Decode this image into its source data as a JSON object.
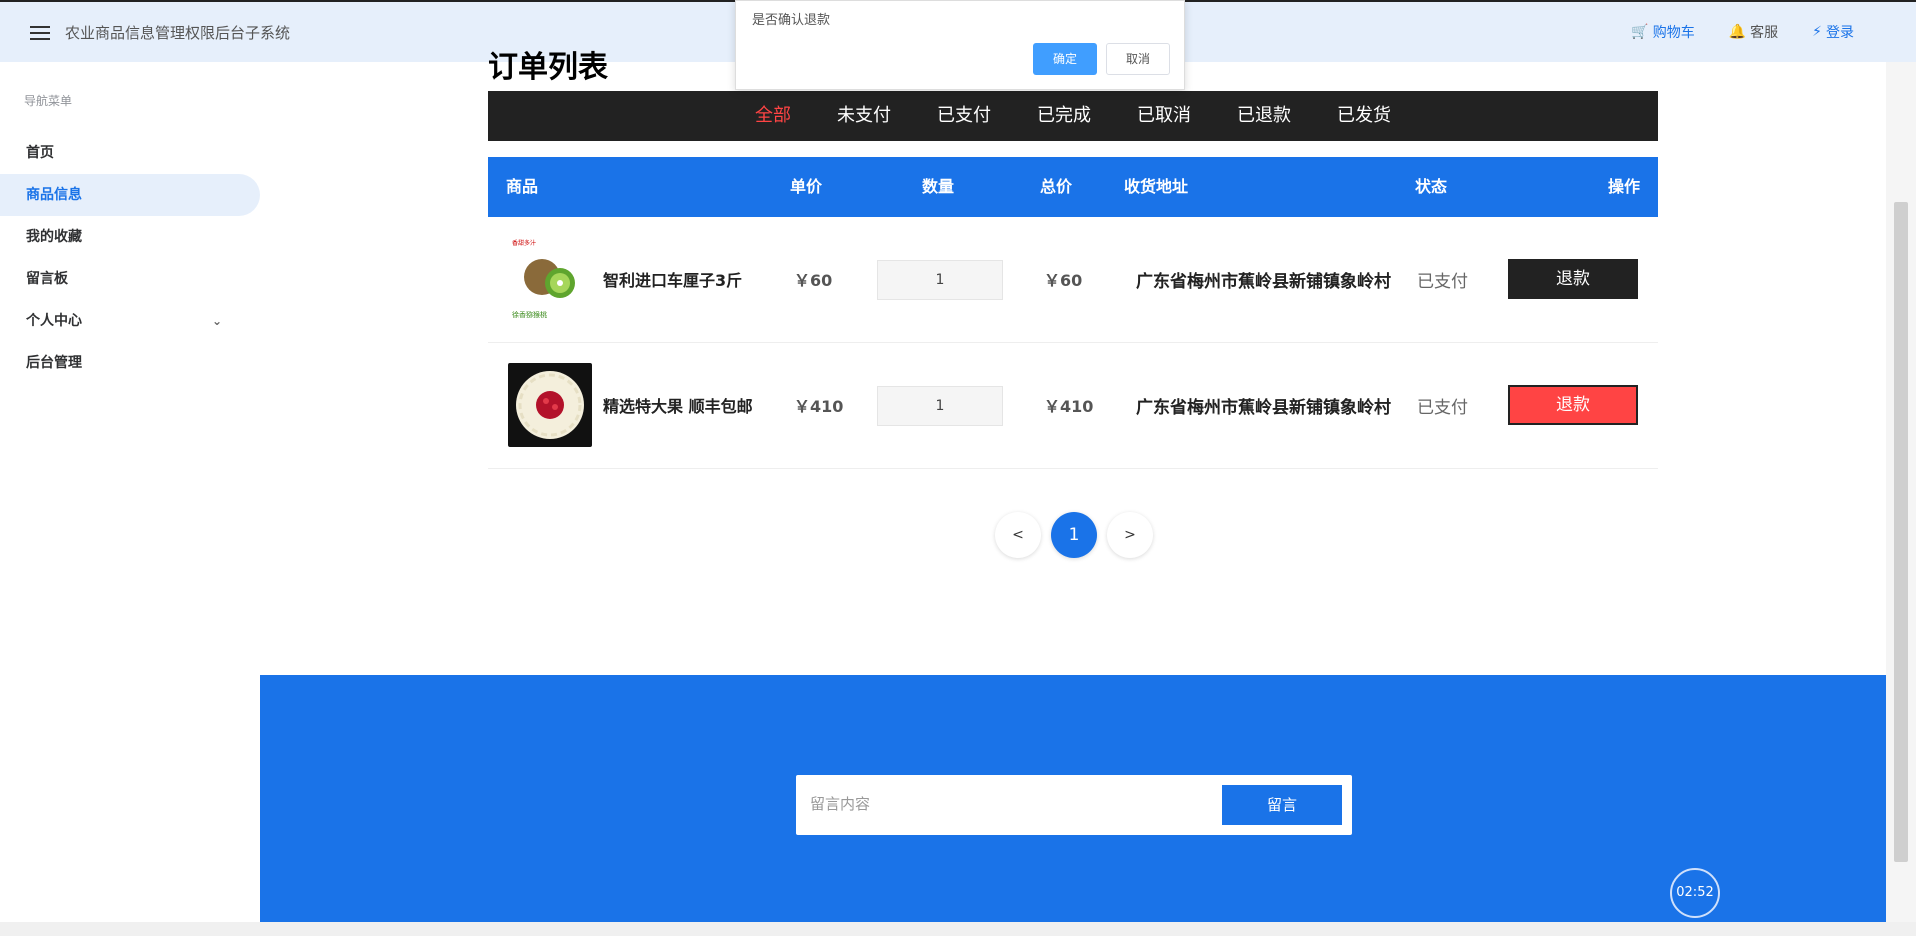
{
  "app": {
    "title": "农业商品信息管理权限后台子系统"
  },
  "top_links": [
    {
      "label": "购物车",
      "icon": "cart-icon"
    },
    {
      "label": "客服",
      "icon": "bell-icon"
    },
    {
      "label": "登录",
      "icon": "bolt-icon"
    }
  ],
  "sidebar": {
    "title": "导航菜单",
    "items": [
      {
        "label": "首页"
      },
      {
        "label": "商品信息",
        "active": true
      },
      {
        "label": "我的收藏"
      },
      {
        "label": "留言板"
      },
      {
        "label": "个人中心",
        "expandable": true
      },
      {
        "label": "后台管理"
      }
    ]
  },
  "page": {
    "heading": "订单列表"
  },
  "tabs": [
    {
      "label": "全部",
      "active": true
    },
    {
      "label": "未支付"
    },
    {
      "label": "已支付"
    },
    {
      "label": "已完成"
    },
    {
      "label": "已取消"
    },
    {
      "label": "已退款"
    },
    {
      "label": "已发货"
    }
  ],
  "table": {
    "headers": [
      "商品",
      "单价",
      "数量",
      "总价",
      "收货地址",
      "状态",
      "操作"
    ],
    "rows": [
      {
        "name": "智利进口车厘子3斤",
        "price": "￥60",
        "qty": "1",
        "total": "￥60",
        "address": "广东省梅州市蕉岭县新铺镇象岭村",
        "status": "已支付",
        "action": "退款"
      },
      {
        "name": "精选特大果 顺丰包邮",
        "price": "￥410",
        "qty": "1",
        "total": "￥410",
        "address": "广东省梅州市蕉岭县新铺镇象岭村",
        "status": "已支付",
        "action": "退款"
      }
    ]
  },
  "pager": {
    "prev": "<",
    "current": "1",
    "next": ">"
  },
  "footer": {
    "placeholder": "留言内容",
    "button": "留言"
  },
  "timer": "02:52",
  "dialog": {
    "text": "是否确认退款",
    "ok": "确定",
    "cancel": "取消"
  },
  "colors": {
    "primary": "#1a73e8",
    "danger": "#ff4444",
    "dark": "#222222"
  }
}
